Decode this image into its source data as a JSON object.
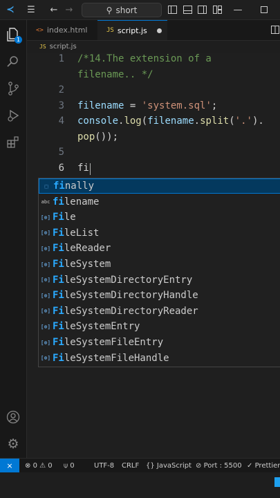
{
  "titlebar": {
    "search_text": "short",
    "icons": [
      "vscode-logo",
      "hamburger-menu-icon",
      "back-arrow-icon",
      "forward-arrow-icon",
      "search-icon",
      "toggle-primary-sidebar-icon",
      "toggle-panel-icon",
      "toggle-secondary-sidebar-icon",
      "customize-layout-icon",
      "minimize-icon",
      "maximize-icon"
    ]
  },
  "activity_bar": {
    "explorer_badge": "1",
    "icons": [
      "files-icon",
      "search-icon",
      "source-control-icon",
      "run-debug-icon",
      "extensions-icon",
      "account-icon",
      "settings-gear-icon"
    ]
  },
  "tabs": [
    {
      "label": "index.html",
      "icon": "<>",
      "active": false
    },
    {
      "label": "script.js",
      "icon": "JS",
      "active": true,
      "dirty": true
    }
  ],
  "breadcrumb": {
    "icon": "JS",
    "file": "script.js"
  },
  "editor": {
    "lines": [
      {
        "number": "1",
        "text": "/*14.The extension of a"
      },
      {
        "number": "",
        "text": "filename.. */"
      },
      {
        "number": "2",
        "text": ""
      },
      {
        "number": "3",
        "segments": [
          [
            "filename",
            "var"
          ],
          [
            " = ",
            "op"
          ],
          [
            "'system.sql'",
            "str"
          ],
          [
            ";",
            "op"
          ]
        ]
      },
      {
        "number": "4",
        "segments": [
          [
            "console",
            "var"
          ],
          [
            ".",
            "op"
          ],
          [
            "log",
            "fn"
          ],
          [
            "(",
            "op"
          ],
          [
            "filename",
            "var"
          ],
          [
            ".",
            "op"
          ],
          [
            "split",
            "fn"
          ],
          [
            "(",
            "op"
          ],
          [
            "'.'",
            "str"
          ],
          [
            ").",
            "op"
          ]
        ]
      },
      {
        "number": "",
        "segments": [
          [
            "pop",
            "fn"
          ],
          [
            "());",
            "op"
          ]
        ]
      },
      {
        "number": "5",
        "text": ""
      },
      {
        "number": "6",
        "text": "fi"
      }
    ],
    "current_line": "6"
  },
  "suggestions": [
    {
      "match": "fi",
      "rest": "nally",
      "kind": "keyword",
      "selected": true
    },
    {
      "match": "fi",
      "rest": "lename",
      "kind": "word",
      "selected": false
    },
    {
      "match": "Fi",
      "rest": "le",
      "kind": "variable",
      "selected": false
    },
    {
      "match": "Fi",
      "rest": "leList",
      "kind": "variable",
      "selected": false
    },
    {
      "match": "Fi",
      "rest": "leReader",
      "kind": "variable",
      "selected": false
    },
    {
      "match": "Fi",
      "rest": "leSystem",
      "kind": "variable",
      "selected": false
    },
    {
      "match": "Fi",
      "rest": "leSystemDirectoryEntry",
      "kind": "variable",
      "selected": false
    },
    {
      "match": "Fi",
      "rest": "leSystemDirectoryHandle",
      "kind": "variable",
      "selected": false
    },
    {
      "match": "Fi",
      "rest": "leSystemDirectoryReader",
      "kind": "variable",
      "selected": false
    },
    {
      "match": "Fi",
      "rest": "leSystemEntry",
      "kind": "variable",
      "selected": false
    },
    {
      "match": "Fi",
      "rest": "leSystemFileEntry",
      "kind": "variable",
      "selected": false
    },
    {
      "match": "Fi",
      "rest": "leSystemFileHandle",
      "kind": "variable",
      "selected": false
    }
  ],
  "statusbar": {
    "errors": "0",
    "warnings": "0",
    "ports": "0",
    "encoding": "UTF-8",
    "eol": "CRLF",
    "language": "JavaScript",
    "port": "Port : 5500",
    "prettier": "Prettier"
  },
  "colors": {
    "accent": "#0078d4",
    "selection": "#04395e",
    "match_highlight": "#2aaaff",
    "string": "#ce9178",
    "variable": "#9cdcfe",
    "function": "#dcdcaa",
    "comment": "#6a9955"
  }
}
